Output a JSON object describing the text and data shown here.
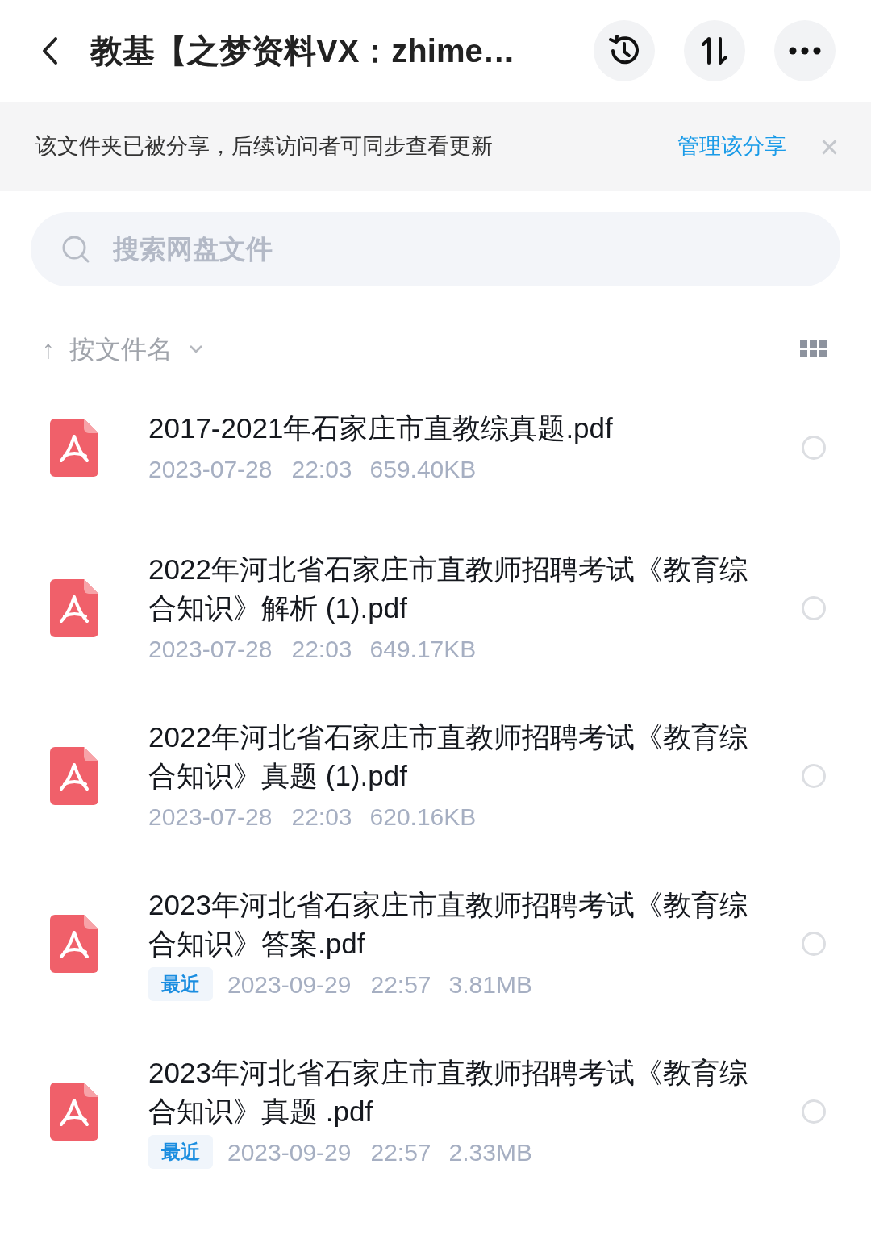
{
  "header": {
    "title": "教基【之梦资料VX：zhime…"
  },
  "share_banner": {
    "message": "该文件夹已被分享，后续访问者可同步查看更新",
    "link": "管理该分享",
    "close": "×"
  },
  "search": {
    "placeholder": "搜索网盘文件"
  },
  "sort": {
    "arrow": "↑",
    "label": "按文件名"
  },
  "files": [
    {
      "name": "2017-2021年石家庄市直教综真题.pdf",
      "date": "2023-07-28",
      "time": "22:03",
      "size": "659.40KB",
      "selected": false
    },
    {
      "name": "2022年河北省石家庄市直教师招聘考试《教育综合知识》解析 (1).pdf",
      "date": "2023-07-28",
      "time": "22:03",
      "size": "649.17KB",
      "selected": false
    },
    {
      "name": "2022年河北省石家庄市直教师招聘考试《教育综合知识》真题 (1).pdf",
      "date": "2023-07-28",
      "time": "22:03",
      "size": "620.16KB",
      "selected": false
    },
    {
      "name": "2023年河北省石家庄市直教师招聘考试《教育综合知识》答案.pdf",
      "tag": "最近",
      "date": "2023-09-29",
      "time": "22:57",
      "size": "3.81MB",
      "selected": false
    },
    {
      "name": "2023年河北省石家庄市直教师招聘考试《教育综合知识》真题 .pdf",
      "tag": "最近",
      "date": "2023-09-29",
      "time": "22:57",
      "size": "2.33MB",
      "selected": false
    }
  ]
}
